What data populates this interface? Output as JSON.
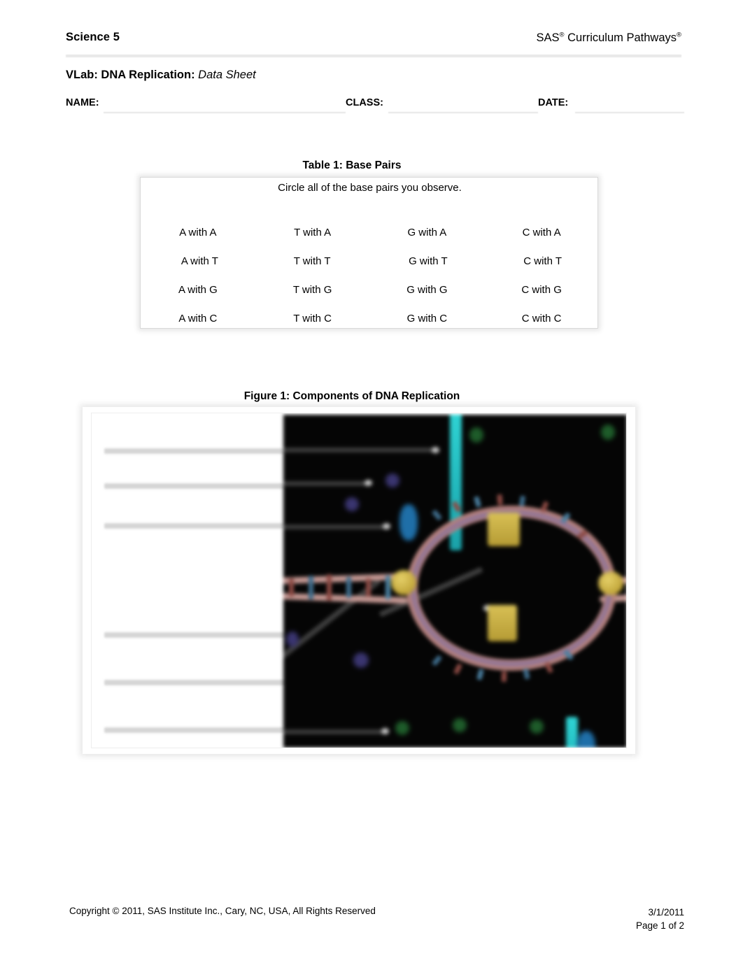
{
  "header": {
    "left_title": "Science 5",
    "brand_part1": "SAS",
    "brand_reg1": "®",
    "brand_part2": " Curriculum Pathways",
    "brand_reg2": "®"
  },
  "doc_title": {
    "bold_part": "VLab: DNA Replication:",
    "italic_part": "Data Sheet"
  },
  "id_fields": [
    {
      "label": "NAME:",
      "value": ""
    },
    {
      "label": "CLASS:",
      "value": ""
    },
    {
      "label": "DATE:",
      "value": ""
    }
  ],
  "table1": {
    "caption": "Table 1: Base Pairs",
    "instruction": "Circle all of the base pairs you observe.",
    "rows": [
      [
        "A with A",
        "T with A",
        "G with A",
        "C with A"
      ],
      [
        "A with T",
        "T with T",
        "G with T",
        "C with T"
      ],
      [
        "A with G",
        "T with G",
        "G with G",
        "C with G"
      ],
      [
        "A with C",
        "T with C",
        "G with C",
        "C with C"
      ]
    ]
  },
  "figure1": {
    "caption": "Figure 1: Components of DNA Replication",
    "description": "Blurred screenshot of a DNA replication virtual lab: a black illustration panel showing a double helix opening into a replication bubble with yellow enzyme blocks and cyan marker bars, beside a white panel of blank label lines.",
    "answer_line_count": 6,
    "colors": {
      "panel_background": "#050505",
      "dna_backbone": "#b4807c",
      "enzyme": "#c8ab3e",
      "marker_bar": "#2fd4d4",
      "leader_line": "#3a3a3a",
      "answer_line": "#d6d6d6"
    }
  },
  "footer": {
    "copyright": "Copyright © 2011, SAS Institute Inc., Cary, NC, USA, All Rights Reserved",
    "date": "3/1/2011",
    "page": "Page 1 of 2"
  }
}
